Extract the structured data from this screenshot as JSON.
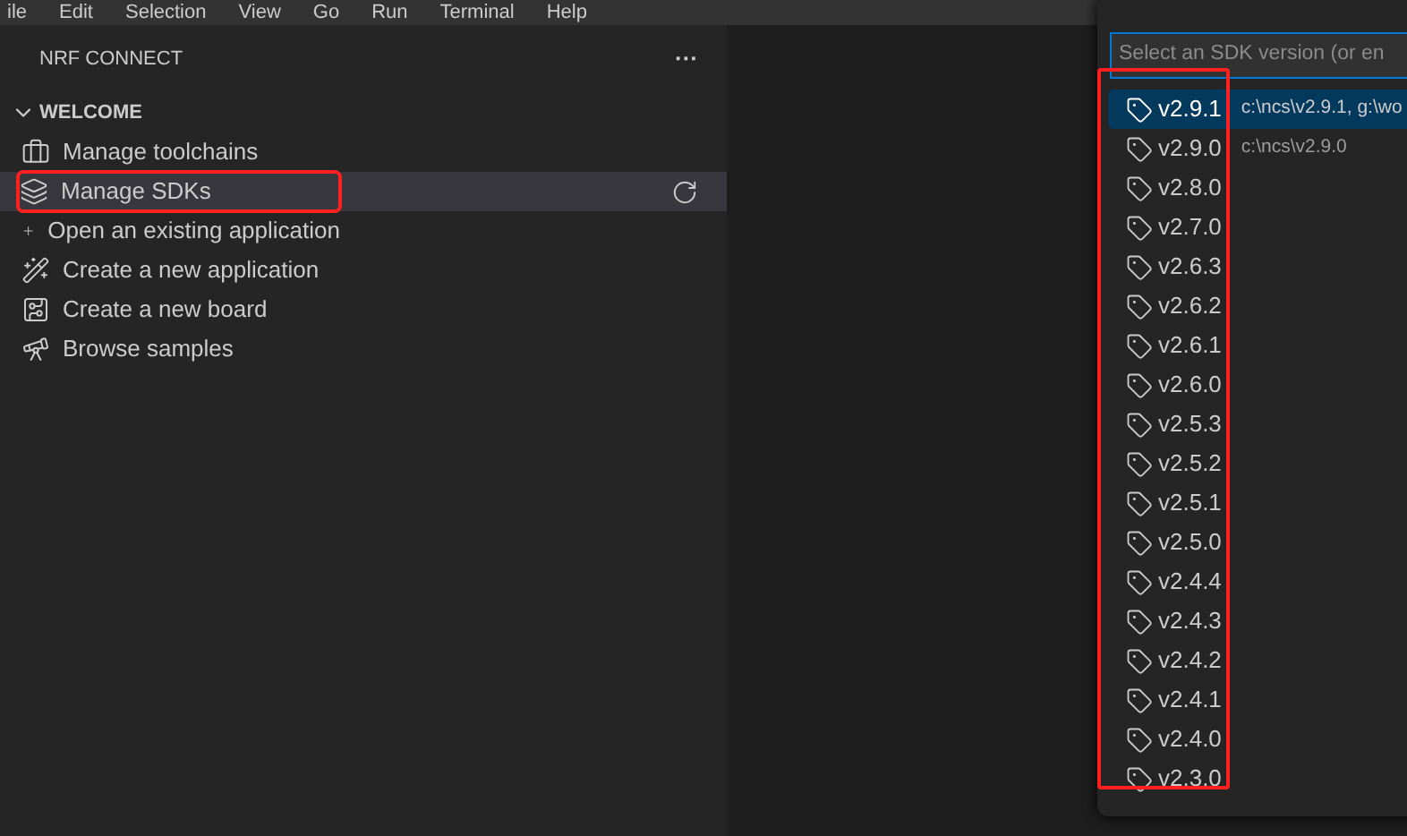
{
  "menu_bar": [
    "ile",
    "Edit",
    "Selection",
    "View",
    "Go",
    "Run",
    "Terminal",
    "Help"
  ],
  "sidebar": {
    "title": "NRF CONNECT",
    "more": "···",
    "section": {
      "title": "WELCOME",
      "expanded": true,
      "items": [
        {
          "kind": "toolchain",
          "label": "Manage toolchains",
          "hovered": false,
          "annotated": false
        },
        {
          "kind": "sdk",
          "label": "Manage SDKs",
          "hovered": true,
          "annotated": true
        },
        {
          "kind": "open",
          "label": "Open an existing application",
          "hovered": false,
          "annotated": false
        },
        {
          "kind": "new-app",
          "label": "Create a new application",
          "hovered": false,
          "annotated": false
        },
        {
          "kind": "new-board",
          "label": "Create a new board",
          "hovered": false,
          "annotated": false
        },
        {
          "kind": "samples",
          "label": "Browse samples",
          "hovered": false,
          "annotated": false
        }
      ]
    }
  },
  "quick_pick": {
    "placeholder": "Select an SDK version (or en",
    "annotated": true,
    "items": [
      {
        "label": "v2.9.1",
        "description": "c:\\ncs\\v2.9.1, g:\\wo",
        "selected": true
      },
      {
        "label": "v2.9.0",
        "description": "c:\\ncs\\v2.9.0",
        "selected": false
      },
      {
        "label": "v2.8.0",
        "selected": false
      },
      {
        "label": "v2.7.0",
        "selected": false
      },
      {
        "label": "v2.6.3",
        "selected": false
      },
      {
        "label": "v2.6.2",
        "selected": false
      },
      {
        "label": "v2.6.1",
        "selected": false
      },
      {
        "label": "v2.6.0",
        "selected": false
      },
      {
        "label": "v2.5.3",
        "selected": false
      },
      {
        "label": "v2.5.2",
        "selected": false
      },
      {
        "label": "v2.5.1",
        "selected": false
      },
      {
        "label": "v2.5.0",
        "selected": false
      },
      {
        "label": "v2.4.4",
        "selected": false
      },
      {
        "label": "v2.4.3",
        "selected": false
      },
      {
        "label": "v2.4.2",
        "selected": false
      },
      {
        "label": "v2.4.1",
        "selected": false
      },
      {
        "label": "v2.4.0",
        "selected": false
      },
      {
        "label": "v2.3.0",
        "selected": false
      }
    ]
  }
}
